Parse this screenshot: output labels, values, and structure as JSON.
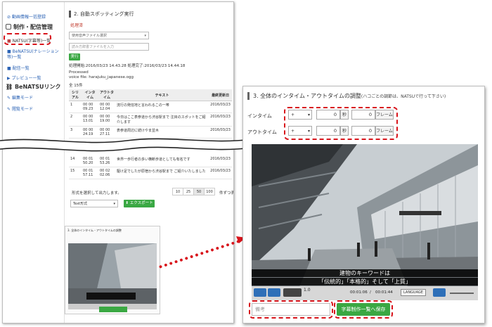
{
  "sidebar": {
    "top_link": "動画情報一括登録",
    "section1": "制作・配信管理",
    "items": [
      "NATSU(字幕等)一覧",
      "BeNATSU(ナレーション等)一覧",
      "配信一覧",
      "プレビュー一覧"
    ],
    "section2": "BeNATSUリンク",
    "items2": [
      "編集モード",
      "閲覧モード"
    ]
  },
  "main": {
    "section_title": "2. 自動スポッティング実行",
    "subheading": "処理済",
    "select_value": "使用音声ファイル選択",
    "dict_placeholder": "読み方辞書ファイルを入力",
    "run_label": "実行",
    "processed_time": "処理開始:2016/03/23 14.43.28 処理完了:2016/03/23 14.44.18",
    "processed": "Processed",
    "voice_file": "voice file: harajuku_japanese.ogg",
    "count": "全 15件",
    "table_headers": [
      "シリアル",
      "インタイム",
      "アウトタイム",
      "テキスト",
      "最終更新日"
    ],
    "rows": [
      {
        "no": "1",
        "in": "00 00 09.23",
        "out": "00 00 12.04",
        "text": "流行の発信地と言われるこの一帯",
        "date": "2016/03/23"
      },
      {
        "no": "2",
        "in": "00 00 13.01",
        "out": "00 00 19.00",
        "text": "今日はここ表参道から渋谷駅まで 注目のスポットをご紹介します",
        "date": "2016/03/23"
      },
      {
        "no": "3",
        "in": "00 00 24.19",
        "out": "00 00 27.11",
        "text": "表参道周辺に続けやま並木",
        "date": "2016/03/23"
      },
      {
        "no": "14",
        "in": "00 01 50.20",
        "out": "00 01 53.26",
        "text": "世界一歩行者の多い横断歩道としても有名です",
        "date": "2016/03/23"
      },
      {
        "no": "15",
        "in": "00 01 57.11",
        "out": "00 02 02.06",
        "text": "駆け足でしたが原宿から渋谷駅まで ご紹介いたしました",
        "date": "2016/03/23"
      }
    ],
    "export_text": "形式を選択して出力します。",
    "export_select": "Text形式",
    "export_btn": "エクスポート",
    "pager": [
      "10",
      "25",
      "50",
      "100"
    ],
    "pager_suffix": "件ずつ表示",
    "thumb_title": "3. 全体のインタイム・アウトタイムの調整"
  },
  "panel": {
    "title": "3. 全体のインタイム・アウトタイムの調整",
    "title_note": "(ハコごとの調節は、NATSUで行って下さい)",
    "in_label": "インタイム",
    "out_label": "アウトタイム",
    "sign": "+",
    "sec_value": "0",
    "sec_unit": "秒",
    "frame_value": "0",
    "frame_unit": "フレーム",
    "caption1": "建物のキーワードは",
    "caption2": "「伝統的」「本格的」そして「上質」",
    "speed": "1.0",
    "time_current": "00:01:06",
    "time_total": "00:01:44",
    "language_btn": "LANGUAGE",
    "input_placeholder": "備考",
    "save_btn": "字幕制作一覧へ保存"
  }
}
